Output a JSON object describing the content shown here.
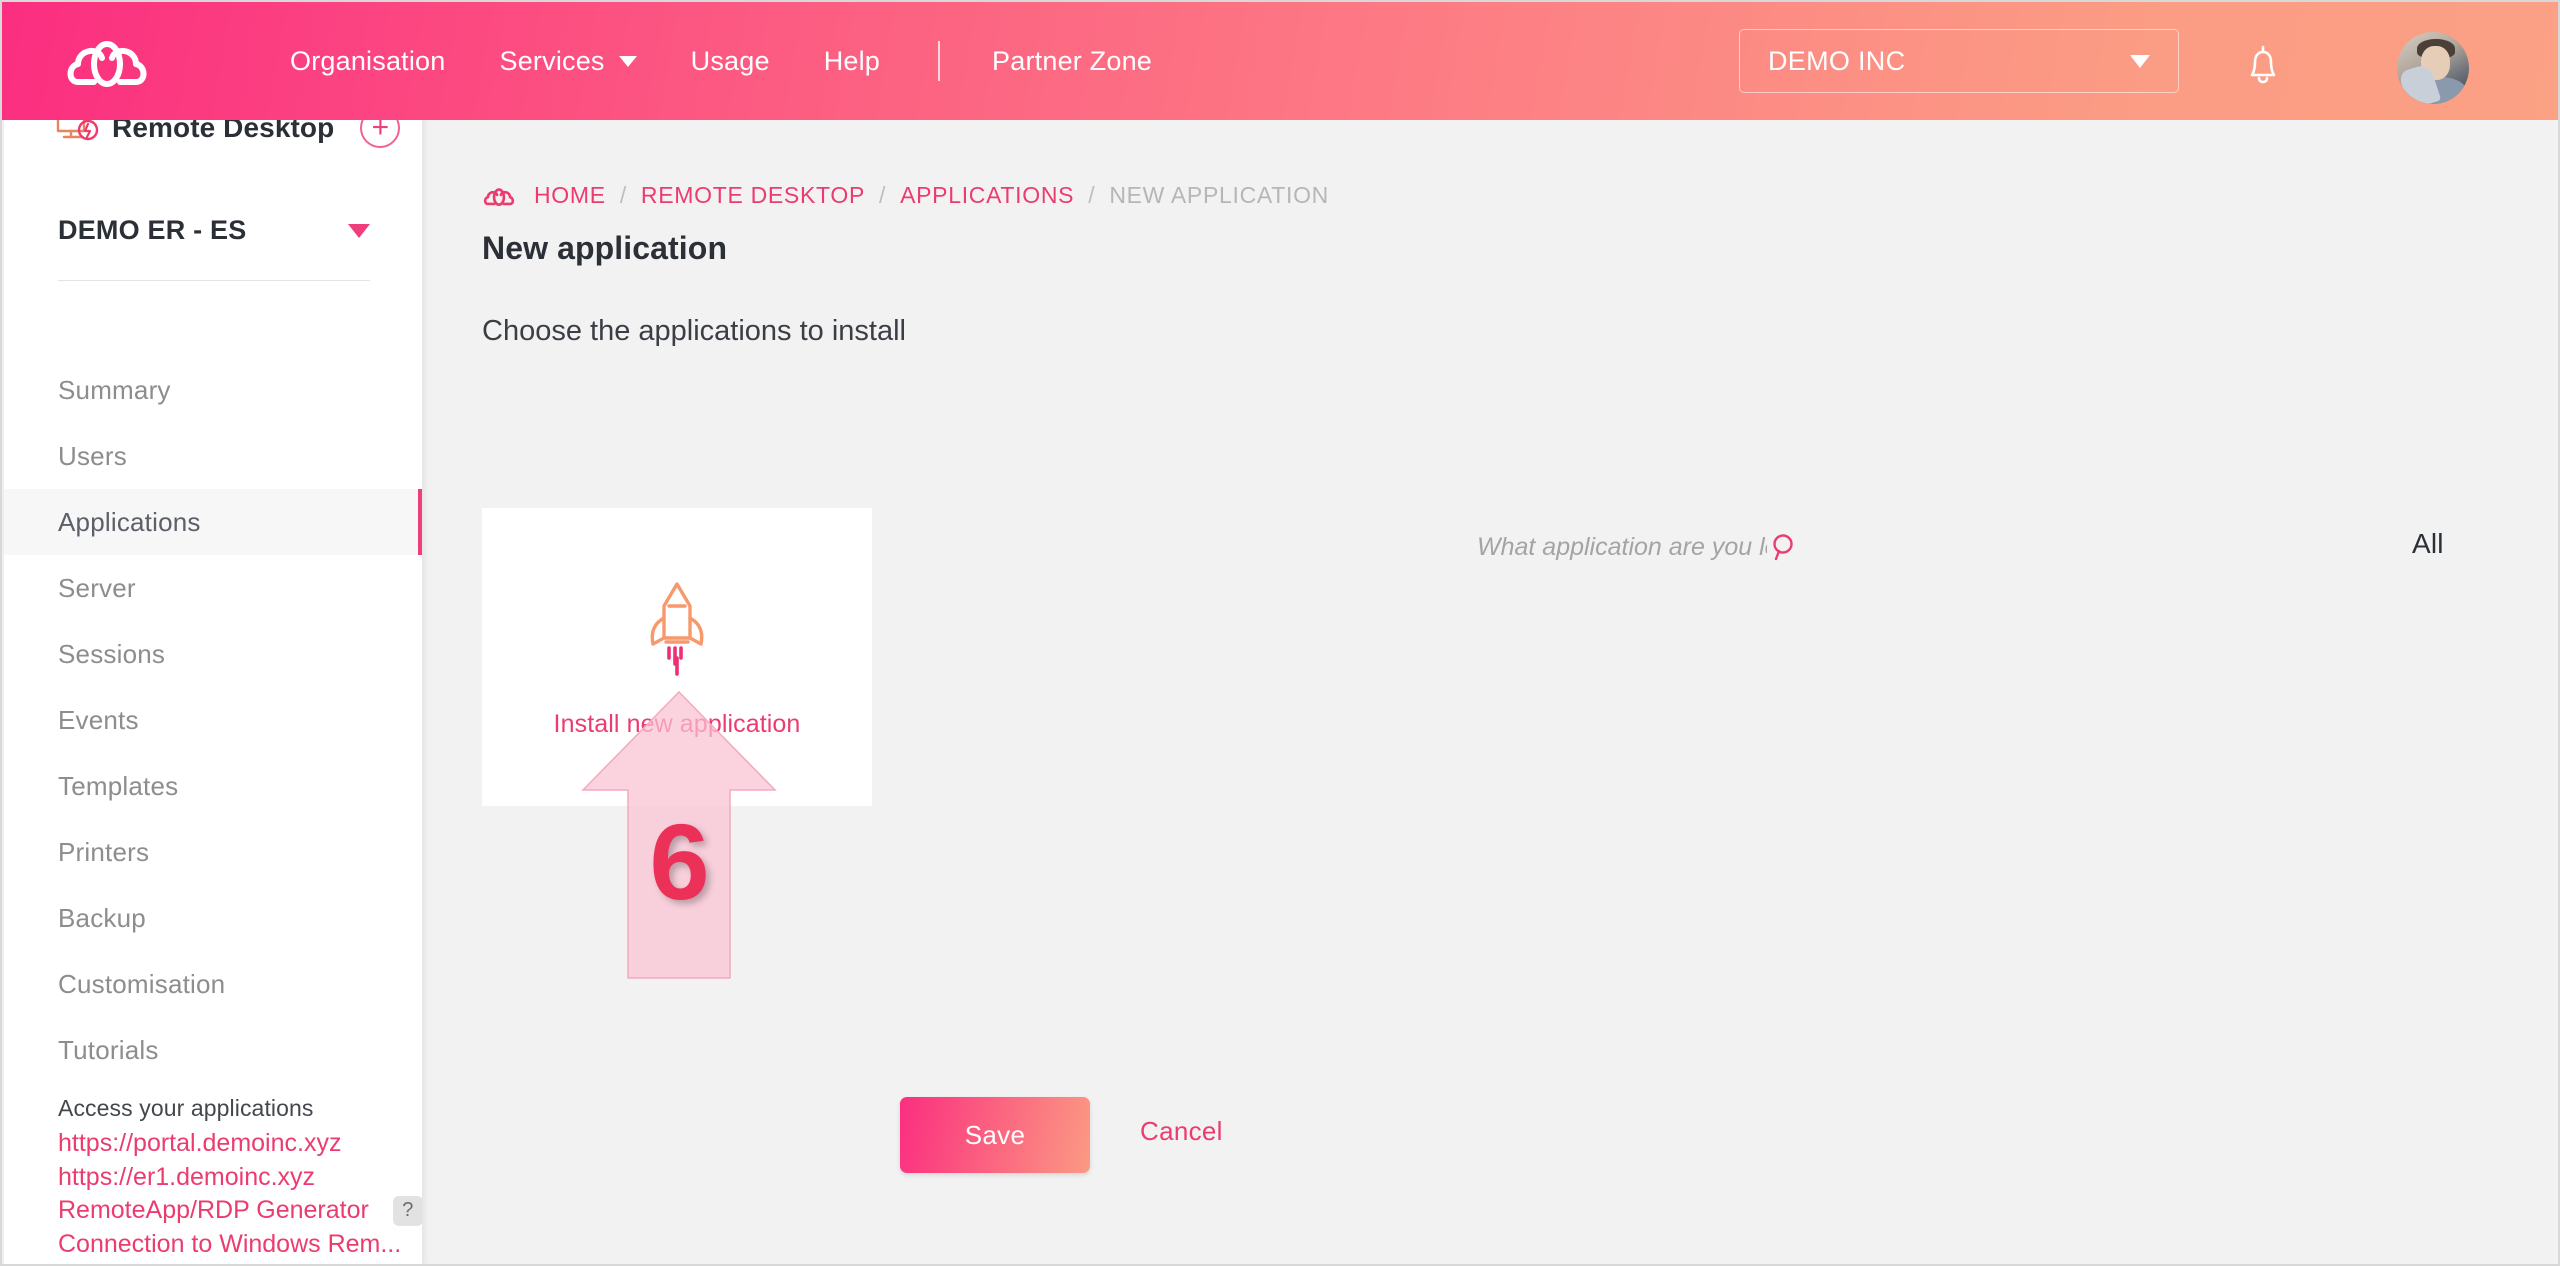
{
  "header": {
    "logo_icon": "cloud-logo-icon",
    "nav": [
      {
        "label": "Organisation",
        "has_caret": false
      },
      {
        "label": "Services",
        "has_caret": true
      },
      {
        "label": "Usage",
        "has_caret": false
      },
      {
        "label": "Help",
        "has_caret": false
      },
      {
        "label": "Partner Zone",
        "has_caret": false
      }
    ],
    "org_selector": {
      "value": "DEMO INC",
      "caret_icon": "chevron-down-icon"
    },
    "bell_icon": "notification-bell-icon",
    "avatar_icon": "user-avatar"
  },
  "sidebar": {
    "service_title": "Remote Desktop",
    "service_icon": "remote-desktop-icon",
    "add_button_label": "+",
    "org_name": "DEMO ER - ES",
    "org_caret_icon": "chevron-down-icon",
    "menu": [
      {
        "label": "Summary",
        "active": false
      },
      {
        "label": "Users",
        "active": false
      },
      {
        "label": "Applications",
        "active": true
      },
      {
        "label": "Server",
        "active": false
      },
      {
        "label": "Sessions",
        "active": false
      },
      {
        "label": "Events",
        "active": false
      },
      {
        "label": "Templates",
        "active": false
      },
      {
        "label": "Printers",
        "active": false
      },
      {
        "label": "Backup",
        "active": false
      },
      {
        "label": "Customisation",
        "active": false
      },
      {
        "label": "Tutorials",
        "active": false
      }
    ],
    "access": {
      "title": "Access your applications",
      "links": [
        "https://portal.demoinc.xyz",
        "https://er1.demoinc.xyz",
        "RemoteApp/RDP Generator",
        "Connection to Windows Rem..."
      ],
      "help_badge": "?"
    }
  },
  "main": {
    "breadcrumb": {
      "home_icon": "cloud-logo-icon",
      "items": [
        "HOME",
        "REMOTE DESKTOP",
        "APPLICATIONS",
        "NEW APPLICATION"
      ],
      "separator": "/",
      "current_index": 3
    },
    "page_title": "New application",
    "subtitle": "Choose the applications to install",
    "search": {
      "placeholder": "What application are you loc",
      "value": "",
      "icon": "search-icon"
    },
    "filter": {
      "value": "All",
      "caret_icon": "chevron-down-icon"
    },
    "install_card": {
      "icon": "rocket-icon",
      "label": "Install new application"
    },
    "buttons": {
      "save": "Save",
      "cancel": "Cancel"
    }
  },
  "annotation": {
    "step_number": "6",
    "shape": "up-arrow-callout"
  },
  "colors": {
    "brand_pink": "#ec3c6f",
    "brand_pink_vivid": "#fb2e80",
    "brand_orange": "#fba184",
    "page_background": "#f2f2f2",
    "sidebar_background": "#ffffff",
    "annotation_pink": "#ec3158"
  }
}
